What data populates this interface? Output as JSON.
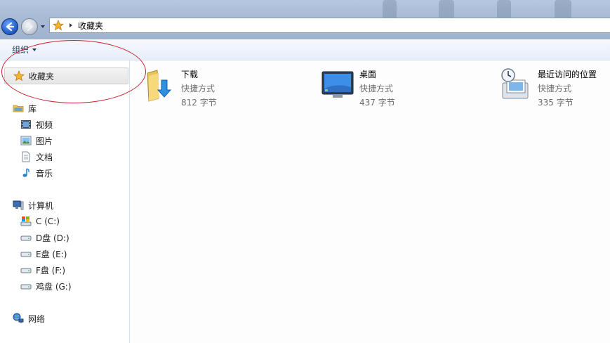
{
  "address": {
    "crumb": "收藏夹"
  },
  "toolbar": {
    "organize_label": "组织"
  },
  "navpane": {
    "favorites": "收藏夹",
    "library": "库",
    "library_items": [
      "视频",
      "图片",
      "文档",
      "音乐"
    ],
    "computer": "计算机",
    "drives": [
      "C (C:)",
      "D盘 (D:)",
      "E盘 (E:)",
      "F盘 (F:)",
      "鸡盘 (G:)"
    ],
    "network": "网络"
  },
  "items": [
    {
      "name": "下载",
      "type": "快捷方式",
      "size": "812 字节",
      "icon": "downloads-folder-icon"
    },
    {
      "name": "桌面",
      "type": "快捷方式",
      "size": "437 字节",
      "icon": "desktop-icon"
    },
    {
      "name": "最近访问的位置",
      "type": "快捷方式",
      "size": "335 字节",
      "icon": "recent-places-icon"
    }
  ],
  "colors": {
    "annotation": "#c9232f",
    "accent": "#2a66d4"
  }
}
